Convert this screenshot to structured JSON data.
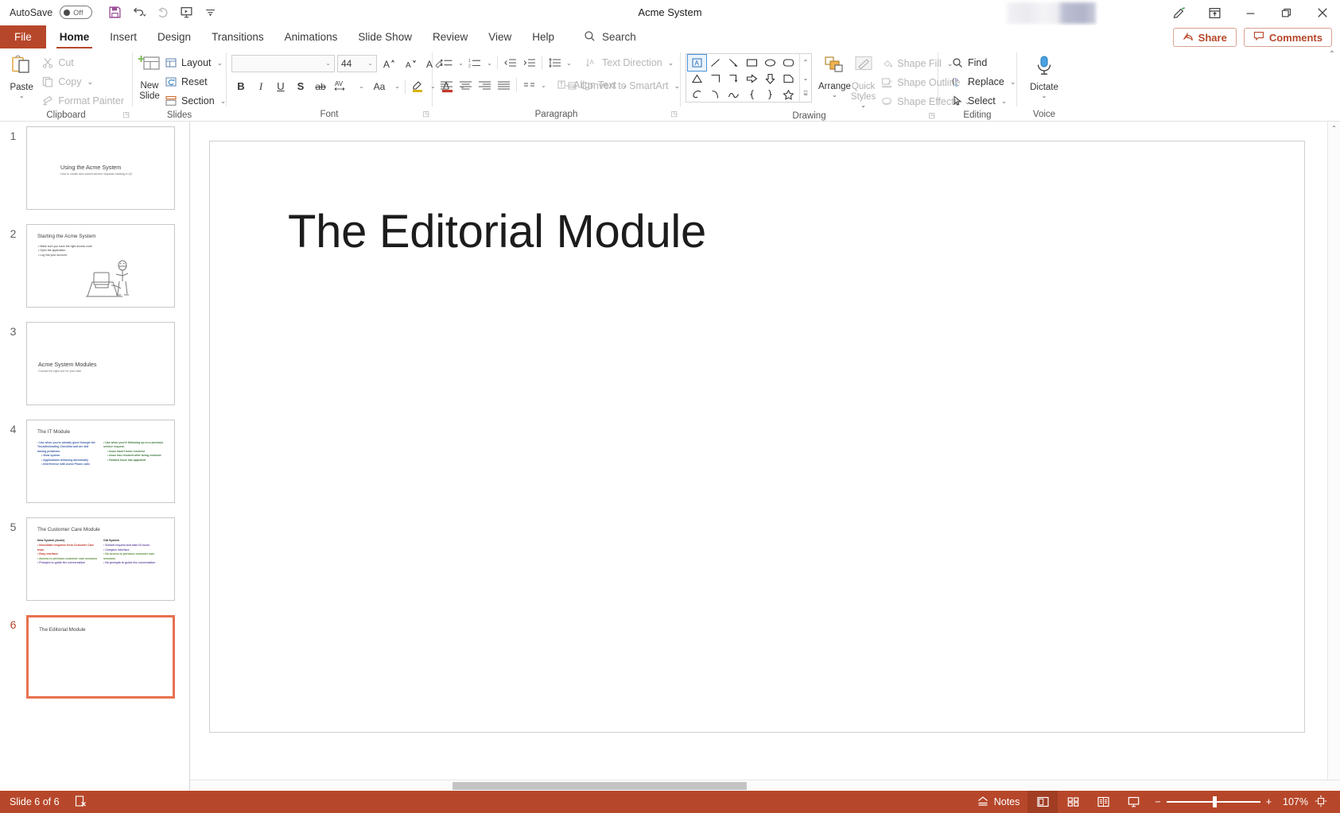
{
  "app": {
    "title": "Acme System",
    "autosave_label": "AutoSave",
    "autosave_state": "Off",
    "accent": "#b7472a"
  },
  "quick_access": [
    {
      "name": "save-icon",
      "tooltip": "Save"
    },
    {
      "name": "undo-icon",
      "tooltip": "Undo"
    },
    {
      "name": "redo-icon",
      "tooltip": "Redo"
    },
    {
      "name": "start-slideshow-icon",
      "tooltip": "Start From Beginning"
    },
    {
      "name": "customize-qat-icon",
      "tooltip": "Customize Quick Access Toolbar"
    }
  ],
  "window_buttons": [
    {
      "label": "Ribbon Display Options",
      "icon": "ribbon-display-icon"
    },
    {
      "label": "Minimize",
      "icon": "minimize-icon"
    },
    {
      "label": "Restore",
      "icon": "restore-icon"
    },
    {
      "label": "Close",
      "icon": "close-icon"
    }
  ],
  "tabs": [
    {
      "label": "File",
      "active": false
    },
    {
      "label": "Home",
      "active": true
    },
    {
      "label": "Insert",
      "active": false
    },
    {
      "label": "Design",
      "active": false
    },
    {
      "label": "Transitions",
      "active": false
    },
    {
      "label": "Animations",
      "active": false
    },
    {
      "label": "Slide Show",
      "active": false
    },
    {
      "label": "Review",
      "active": false
    },
    {
      "label": "View",
      "active": false
    },
    {
      "label": "Help",
      "active": false
    }
  ],
  "search": {
    "label": "Search",
    "placeholder": "Search"
  },
  "header_actions": {
    "share": "Share",
    "comments": "Comments"
  },
  "ribbon": {
    "clipboard": {
      "label": "Clipboard",
      "paste": "Paste",
      "cut": "Cut",
      "copy": "Copy",
      "format_painter": "Format Painter"
    },
    "slides": {
      "label": "Slides",
      "new_slide": "New\nSlide",
      "new_slide_line1": "New",
      "new_slide_line2": "Slide",
      "layout": "Layout",
      "reset": "Reset",
      "section": "Section"
    },
    "font": {
      "label": "Font",
      "font_name": "",
      "font_name_placeholder": "",
      "font_size": "44",
      "increase_size": "A",
      "decrease_size": "A",
      "clear_formatting": "Clear All Formatting",
      "bold": "B",
      "italic": "I",
      "underline": "U",
      "shadow": "S",
      "strikethrough": "ab",
      "character_spacing": "AV",
      "change_case": "Aa",
      "text_highlight": "Text Highlight Color",
      "font_color": "Font Color"
    },
    "paragraph": {
      "label": "Paragraph",
      "text_direction": "Text Direction",
      "align_text": "Align Text",
      "convert_smartart": "Convert to SmartArt"
    },
    "drawing": {
      "label": "Drawing",
      "arrange": "Arrange",
      "quick_styles_line1": "Quick",
      "quick_styles_line2": "Styles",
      "shape_fill": "Shape Fill",
      "shape_outline": "Shape Outline",
      "shape_effects": "Shape Effects"
    },
    "editing": {
      "label": "Editing",
      "find": "Find",
      "replace": "Replace",
      "select": "Select"
    },
    "voice": {
      "label": "Voice",
      "dictate": "Dictate"
    }
  },
  "thumbnails": [
    {
      "number": "1",
      "selected": false,
      "title": "Using the Acme System",
      "subtitle": "How to create and submit service requests starting in Q3",
      "layout": "title-slide"
    },
    {
      "number": "2",
      "selected": false,
      "title": "Starting the Acme System",
      "bullets": [
        "Make sure you have the right access code",
        "Open the application",
        "Log into your account"
      ],
      "has_image": true,
      "layout": "content-with-art"
    },
    {
      "number": "3",
      "selected": false,
      "title": "Acme System Modules",
      "subtitle": "Choose the right one for your task",
      "layout": "section-header"
    },
    {
      "number": "4",
      "selected": false,
      "title": "The IT Module",
      "layout": "two-content",
      "columns": [
        {
          "bullets": [
            "Use when you're already gone through the Troubleshooting Checklist and are still having problems."
          ],
          "subbullets": [
            "Slow system",
            "Applications behaving abnormally",
            "Interference with Acme Phone calls"
          ],
          "color": "#3b5ea8"
        },
        {
          "bullets": [
            "Use when you're following up on a previous service request."
          ],
          "subbullets": [
            "Issue hasn't been resolved",
            "Issue has returned after being resolved",
            "Related issue has appeared"
          ],
          "color": "#3d7a3d"
        }
      ]
    },
    {
      "number": "5",
      "selected": false,
      "title": "The Customer Care Module",
      "layout": "comparison",
      "columns": [
        {
          "heading": "New System (Acme)",
          "bullets": [
            "Immediate response from Customer Care team",
            "Easy interface",
            "Access to previous customer care sessions",
            "Prompts to guide the conversation"
          ],
          "color": "#c0392b"
        },
        {
          "heading": "Old System",
          "bullets": [
            "Submit request and wait 24 hours",
            "Complex interface",
            "No access to previous customer care sessions",
            "No prompts to guide the conversation"
          ],
          "color": "#6a4fa3"
        }
      ]
    },
    {
      "number": "6",
      "selected": true,
      "title": "The Editorial Module",
      "layout": "title-only"
    }
  ],
  "slide": {
    "title": "The Editorial Module"
  },
  "status": {
    "slide_counter": "Slide 6 of 6",
    "accessibility": "Accessibility: Investigate",
    "notes": "Notes",
    "views": [
      {
        "name": "normal-view",
        "label": "Normal",
        "active": true
      },
      {
        "name": "slide-sorter-view",
        "label": "Slide Sorter",
        "active": false
      },
      {
        "name": "reading-view",
        "label": "Reading View",
        "active": false
      },
      {
        "name": "slideshow-view",
        "label": "Slide Show",
        "active": false
      }
    ],
    "zoom_out": "−",
    "zoom_in": "+",
    "zoom_level": "107%",
    "fit_to_window": "Fit slide to current window"
  }
}
